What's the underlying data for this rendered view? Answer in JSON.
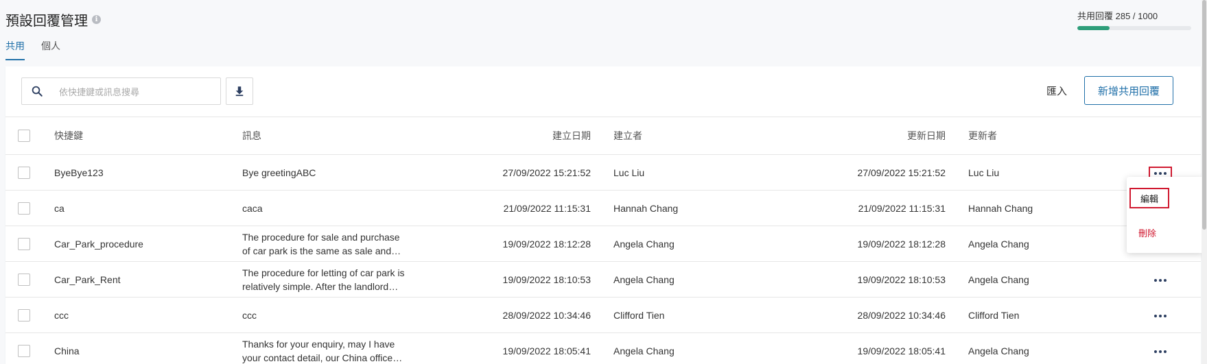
{
  "header": {
    "title": "預設回覆管理",
    "info_icon": "info-icon"
  },
  "tabs": [
    {
      "label": "共用",
      "active": true
    },
    {
      "label": "個人",
      "active": false
    }
  ],
  "quota": {
    "label": "共用回覆 285 / 1000",
    "used": 285,
    "limit": 1000,
    "bar_color": "#2e9e7a"
  },
  "toolbar": {
    "search_placeholder": "依快捷鍵或訊息搜尋",
    "search_value": "",
    "search_icon": "search-icon",
    "download_icon": "download-icon",
    "import_label": "匯入",
    "add_label": "新增共用回覆"
  },
  "table": {
    "columns": {
      "key": "快捷鍵",
      "message": "訊息",
      "created_date": "建立日期",
      "created_by": "建立者",
      "updated_date": "更新日期",
      "updated_by": "更新者"
    },
    "rows": [
      {
        "key": "ByeBye123",
        "message": "Bye greetingABC",
        "created_date": "27/09/2022 15:21:52",
        "created_by": "Luc Liu",
        "updated_date": "27/09/2022 15:21:52",
        "updated_by": "Luc Liu"
      },
      {
        "key": "ca",
        "message": "caca",
        "created_date": "21/09/2022 11:15:31",
        "created_by": "Hannah Chang",
        "updated_date": "21/09/2022 11:15:31",
        "updated_by": "Hannah Chang"
      },
      {
        "key": "Car_Park_procedure",
        "message": "The procedure for sale and purchase of car park is the same as sale and purchase of the flat.",
        "created_date": "19/09/2022 18:12:28",
        "created_by": "Angela Chang",
        "updated_date": "19/09/2022 18:12:28",
        "updated_by": "Angela Chang"
      },
      {
        "key": "Car_Park_Rent",
        "message": "The procedure for letting of car park is relatively simple. After the landlord agrees to rent.",
        "created_date": "19/09/2022 18:10:53",
        "created_by": "Angela Chang",
        "updated_date": "19/09/2022 18:10:53",
        "updated_by": "Angela Chang"
      },
      {
        "key": "ccc",
        "message": "ccc",
        "created_date": "28/09/2022 10:34:46",
        "created_by": "Clifford Tien",
        "updated_date": "28/09/2022 10:34:46",
        "updated_by": "Clifford Tien"
      },
      {
        "key": "China",
        "message": "Thanks for your enquiry, may I have your contact detail, our China office will contact you.",
        "created_date": "19/09/2022 18:05:41",
        "created_by": "Angela Chang",
        "updated_date": "19/09/2022 18:05:41",
        "updated_by": "Angela Chang"
      }
    ]
  },
  "row_menu": {
    "edit_label": "編輯",
    "delete_label": "刪除",
    "delete_color": "#d0182f"
  },
  "colors": {
    "accent": "#1f6fa8",
    "highlight": "#d0182f"
  }
}
